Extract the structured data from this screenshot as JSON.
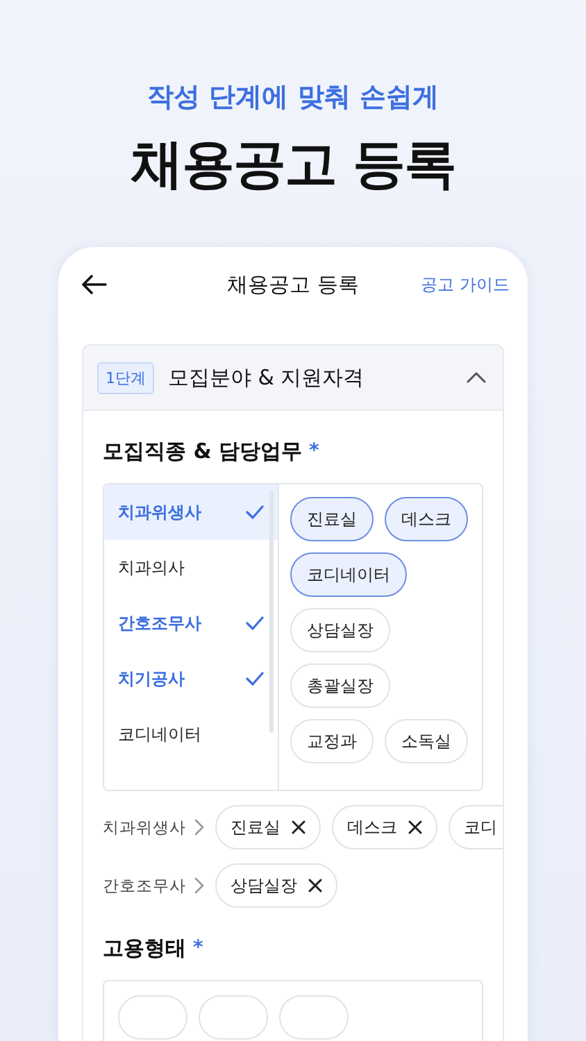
{
  "promo": {
    "subtitle": "작성 단계에 맞춰 손쉽게",
    "title": "채용공고 등록"
  },
  "header": {
    "title": "채용공고 등록",
    "link": "공고 가이드"
  },
  "step": {
    "badge": "1단계",
    "title": "모집분야 & 지원자격",
    "expanded": true
  },
  "job_section": {
    "label": "모집직종 & 담당업무",
    "required": "*",
    "jobs": [
      {
        "label": "치과위생사",
        "selected": true,
        "checked": true
      },
      {
        "label": "치과의사",
        "selected": false,
        "checked": false
      },
      {
        "label": "간호조무사",
        "selected": false,
        "checked": true
      },
      {
        "label": "치기공사",
        "selected": false,
        "checked": true
      },
      {
        "label": "코디네이터",
        "selected": false,
        "checked": false
      }
    ],
    "duties": [
      {
        "label": "진료실",
        "selected": true
      },
      {
        "label": "데스크",
        "selected": true
      },
      {
        "label": "코디네이터",
        "selected": true
      },
      {
        "label": "상담실장",
        "selected": false
      },
      {
        "label": "총괄실장",
        "selected": false
      },
      {
        "label": "교정과",
        "selected": false
      },
      {
        "label": "소독실",
        "selected": false
      }
    ],
    "picked": [
      {
        "job": "치과위생사",
        "duties": [
          {
            "label": "진료실",
            "cut": false
          },
          {
            "label": "데스크",
            "cut": false
          },
          {
            "label": "코디",
            "cut": true
          }
        ]
      },
      {
        "job": "간호조무사",
        "duties": [
          {
            "label": "상담실장",
            "cut": false
          }
        ]
      }
    ]
  },
  "employment_section": {
    "label": "고용형태",
    "required": "*"
  }
}
